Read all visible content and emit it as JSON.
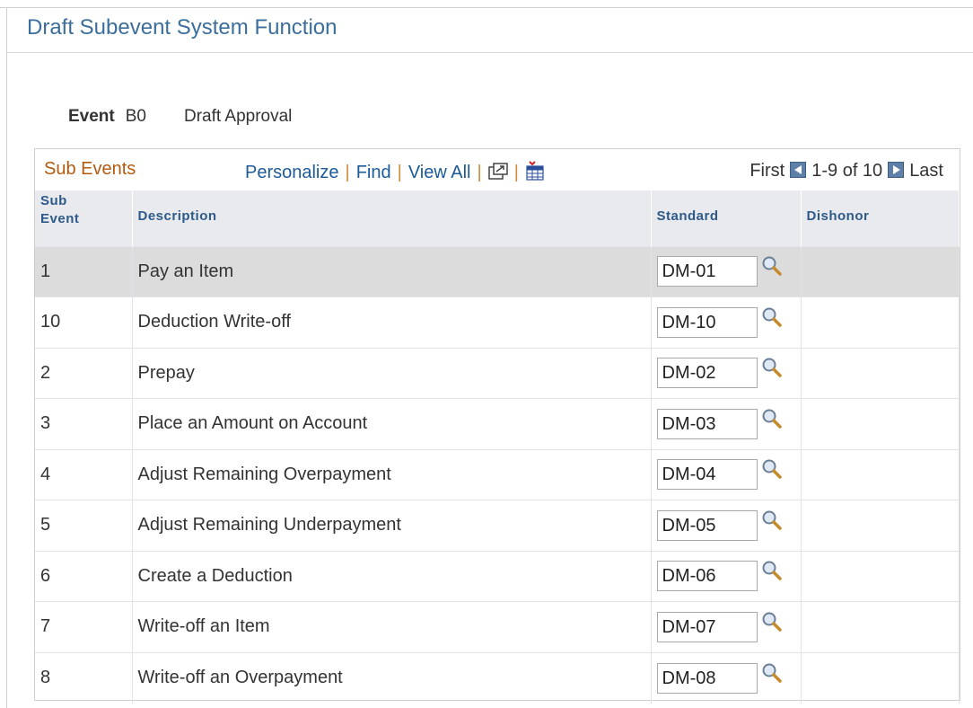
{
  "page": {
    "title": "Draft Subevent System Function"
  },
  "event": {
    "label": "Event",
    "code": "B0",
    "description": "Draft Approval"
  },
  "grid": {
    "title": "Sub Events",
    "tools": {
      "personalize": "Personalize",
      "find": "Find",
      "view_all": "View All",
      "separator": "|"
    },
    "nav": {
      "first": "First",
      "range": "1-9 of 10",
      "last": "Last"
    },
    "columns": {
      "sub_event_line1": "Sub",
      "sub_event_line2": "Event",
      "description": "Description",
      "standard": "Standard",
      "dishonor": "Dishonor"
    },
    "rows": [
      {
        "sub": "1",
        "desc": "Pay an Item",
        "standard": "DM-01",
        "dishonor": ""
      },
      {
        "sub": "10",
        "desc": "Deduction Write-off",
        "standard": "DM-10",
        "dishonor": ""
      },
      {
        "sub": "2",
        "desc": "Prepay",
        "standard": "DM-02",
        "dishonor": ""
      },
      {
        "sub": "3",
        "desc": "Place an Amount on Account",
        "standard": "DM-03",
        "dishonor": ""
      },
      {
        "sub": "4",
        "desc": "Adjust Remaining Overpayment",
        "standard": "DM-04",
        "dishonor": ""
      },
      {
        "sub": "5",
        "desc": "Adjust Remaining Underpayment",
        "standard": "DM-05",
        "dishonor": ""
      },
      {
        "sub": "6",
        "desc": "Create a Deduction",
        "standard": "DM-06",
        "dishonor": ""
      },
      {
        "sub": "7",
        "desc": "Write-off an Item",
        "standard": "DM-07",
        "dishonor": ""
      },
      {
        "sub": "8",
        "desc": "Write-off an Overpayment",
        "standard": "DM-08",
        "dishonor": ""
      }
    ]
  },
  "icons": {
    "new_window": "new-window-icon",
    "download": "download-grid-icon",
    "lookup": "magnifier-icon",
    "prev": "arrow-left-icon",
    "next": "arrow-right-icon"
  },
  "colors": {
    "title": "#3c6e9c",
    "grid_title": "#b25b10",
    "link": "#1c5a98",
    "header_bg": "#e8eaed",
    "highlight_row": "#dcdcdc"
  }
}
